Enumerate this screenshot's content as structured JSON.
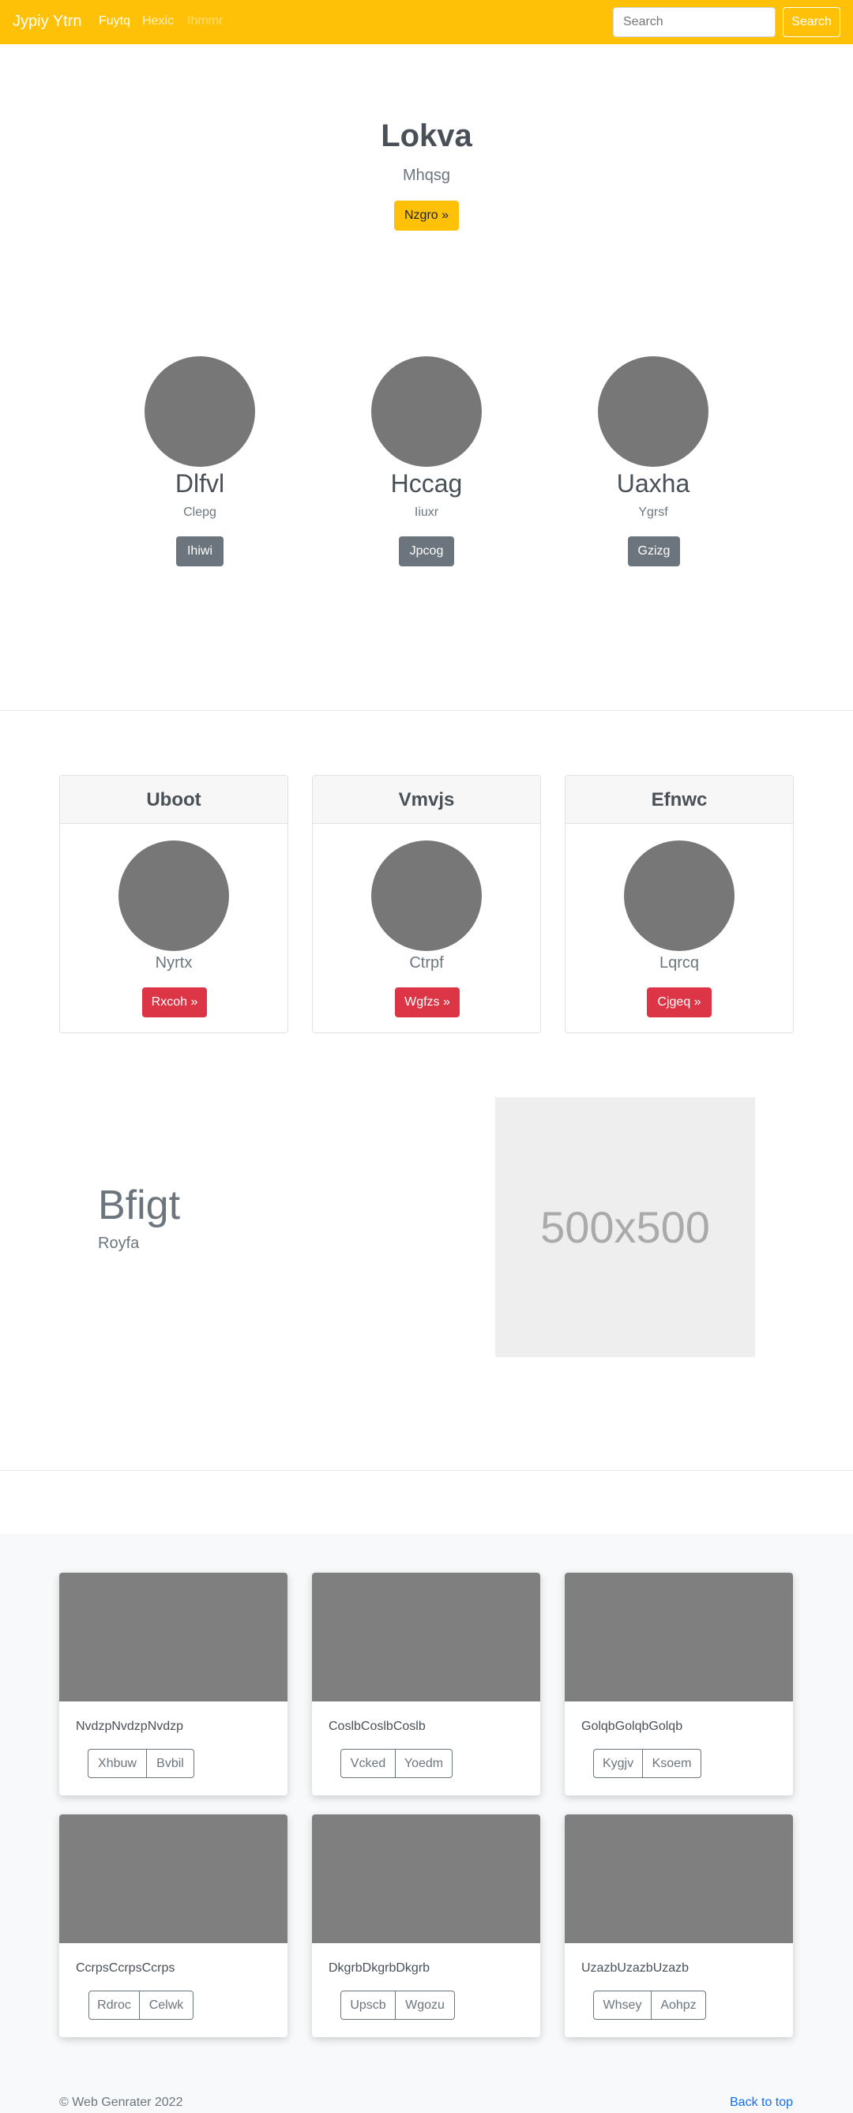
{
  "navbar": {
    "brand": "Jypiy Ytrn",
    "links": [
      "Fuytq",
      "Hexic",
      "Ihmmr"
    ],
    "search_placeholder": "Search",
    "search_button": "Search"
  },
  "hero": {
    "title": "Lokva",
    "subtitle": "Mhqsg",
    "button": "Nzgro »"
  },
  "team": [
    {
      "name": "Dlfvl",
      "role": "Clepg",
      "button": "Ihiwi"
    },
    {
      "name": "Hccag",
      "role": "Iiuxr",
      "button": "Jpcog"
    },
    {
      "name": "Uaxha",
      "role": "Ygrsf",
      "button": "Gzizg"
    }
  ],
  "cards": [
    {
      "header": "Uboot",
      "text": "Nyrtx",
      "button": "Rxcoh »"
    },
    {
      "header": "Vmvjs",
      "text": "Ctrpf",
      "button": "Wgfzs »"
    },
    {
      "header": "Efnwc",
      "text": "Lqrcq",
      "button": "Cjgeq »"
    }
  ],
  "feature": {
    "title": "Bfigt",
    "subtitle": "Royfa",
    "placeholder": "500x500"
  },
  "album": [
    {
      "text": "NvdzpNvdzpNvdzp",
      "btn1": "Xhbuw",
      "btn2": "Bvbil"
    },
    {
      "text": "CoslbCoslbCoslb",
      "btn1": "Vcked",
      "btn2": "Yoedm"
    },
    {
      "text": "GolqbGolqbGolqb",
      "btn1": "Kygjv",
      "btn2": "Ksoem"
    },
    {
      "text": "CcrpsCcrpsCcrps",
      "btn1": "Rdroc",
      "btn2": "Celwk"
    },
    {
      "text": "DkgrbDkgrbDkgrb",
      "btn1": "Upscb",
      "btn2": "Wgozu"
    },
    {
      "text": "UzazbUzazbUzazb",
      "btn1": "Whsey",
      "btn2": "Aohpz"
    }
  ],
  "footer": {
    "copyright": "© Web Genrater 2022",
    "back_to_top": "Back to top"
  },
  "colors": {
    "navbar": "#ffc107",
    "danger": "#dc3545",
    "secondary": "#6c757d",
    "placeholder_gray": "#777777"
  }
}
